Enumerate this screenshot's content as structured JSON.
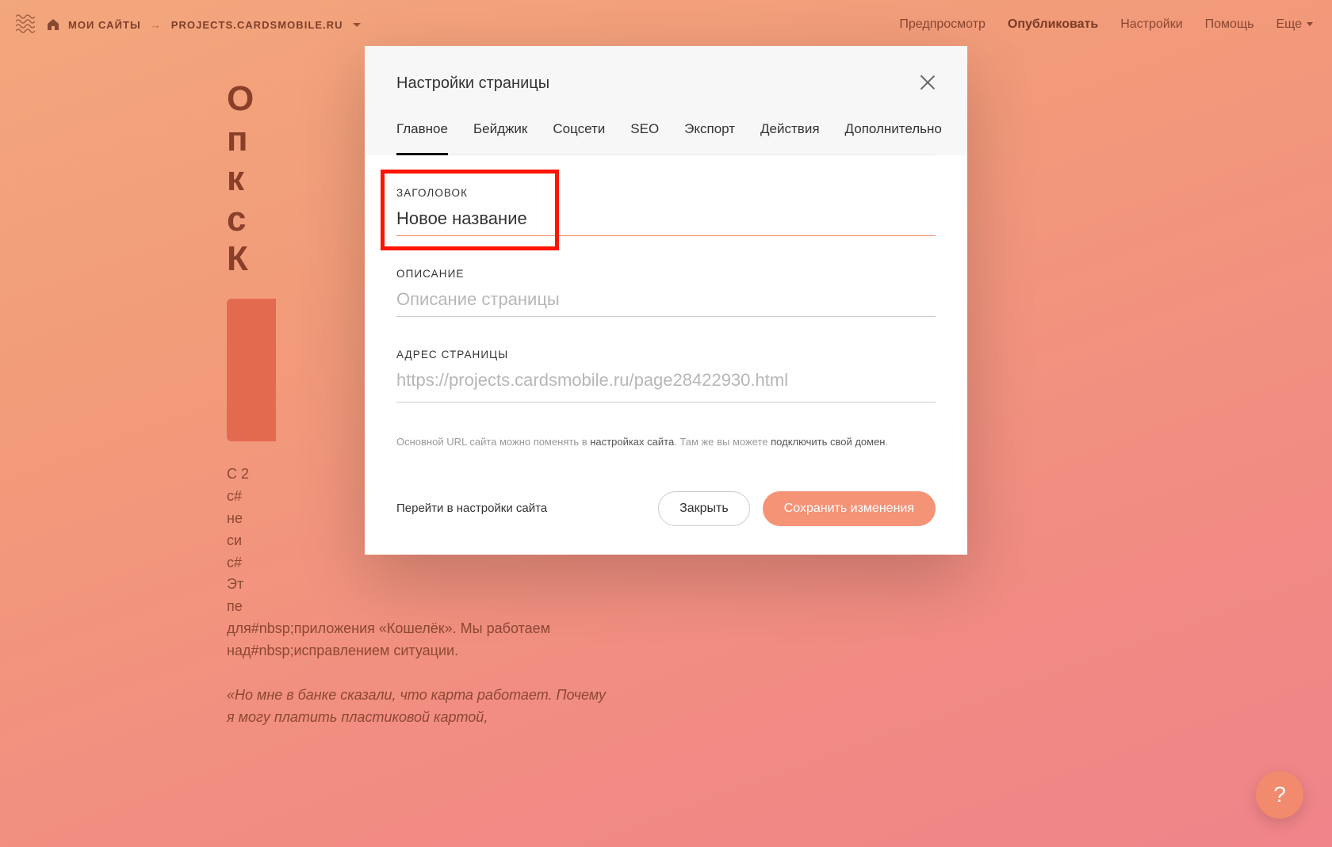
{
  "topbar": {
    "my_sites": "МОИ САЙТЫ",
    "project_domain": "PROJECTS.CARDSMOBILE.RU",
    "nav": {
      "preview": "Предпросмотр",
      "publish": "Опубликовать",
      "settings": "Настройки",
      "help": "Помощь",
      "more": "Еще"
    }
  },
  "background_page": {
    "heading_lines": [
      "О",
      "п",
      "к",
      "с",
      "К"
    ],
    "para1": "С 2\nс#\nне\nси\nс#\nЭт\nпе\nдля#nbsp;приложения «Кошелёк». Мы работаем над#nbsp;исправлением ситуации.",
    "para2": "«Но мне в банке сказали, что карта работает. Почему я могу платить пластиковой картой,"
  },
  "modal": {
    "title": "Настройки страницы",
    "tabs": [
      "Главное",
      "Бейджик",
      "Соцсети",
      "SEO",
      "Экспорт",
      "Действия",
      "Дополнительно"
    ],
    "active_tab_index": 0,
    "fields": {
      "title": {
        "label": "ЗАГОЛОВОК",
        "value": "Новое название"
      },
      "description": {
        "label": "ОПИСАНИЕ",
        "placeholder": "Описание страницы",
        "value": ""
      },
      "url": {
        "label": "АДРЕС СТРАНИЦЫ",
        "prefix": "https://projects.cardsmobile.ru/",
        "value": "page28422930.html"
      }
    },
    "hint": {
      "part1": "Основной URL сайта можно поменять в ",
      "link1": "настройках сайта",
      "part2": ". Там же вы можете ",
      "link2": "подключить свой домен",
      "part3": "."
    },
    "footer": {
      "settings_link": "Перейти в настройки сайта",
      "close": "Закрыть",
      "save": "Сохранить изменения"
    }
  },
  "help_fab": "?"
}
